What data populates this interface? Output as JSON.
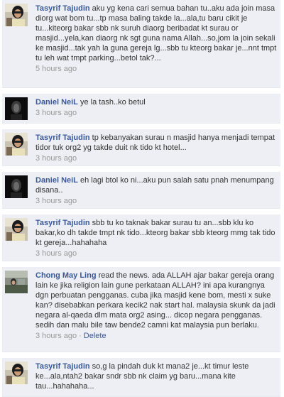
{
  "comments": [
    {
      "author": "Tasyrif Tajudin",
      "text": "aku yg kena cari semua bahan tu..aku ada join masa diorg wat bom tu...tp masa baling takde la...ala,tu baru cikit je tu...kiteorg bakar sbb nk suruh diaorg beribadat kt surau or masjid...yela,kan diaorg nk sgt guna nama Allah...so,jom la join sekali ke masjid...tak yah la guna gereja lg...sbb tu kteorg bakar je...nnt tmpt tu leh wat tmpt parking...betol tak?...",
      "time": "5 hours ago"
    },
    {
      "author": "Daniel NeiL",
      "text": "ye la tash..ko betul",
      "time": "3 hours ago"
    },
    {
      "author": "Tasyrif Tajudin",
      "text": "tp kebanyakan surau n masjid hanya menjadi tempat tidor tuk org2 yg takde duit nk tido kt hotel...",
      "time": "3 hours ago"
    },
    {
      "author": "Daniel NeiL",
      "text": "eh lagi btol ko ni...aku pun salah satu pnah menumpang disana..",
      "time": "3 hours ago"
    },
    {
      "author": "Tasyrif Tajudin",
      "text": "sbb tu ko taknak bakar surau tu an...sbb klu ko bakar,ko dh takde tmpt nk tido...kteorg bakar sbb kteorg mmg tak tido kt gereja...hahahaha",
      "time": "3 hours ago"
    },
    {
      "author": "Chong May Ling",
      "text": "read the news. ada ALLAH ajar bakar gereja orang lain ke jika religion lain gune perkataan ALLAH? ini apa kurangnya dgn perbuatan pengganas. cuba jika masjid kene bom, mesti x suke kan? disebabkan perkara kecik2 nak start hal. malaysia skunk da jadi negara al-qaeda dlm mata org2 asing... dicop negara pengganas. sedih dan malu bile taw bende2 camni kat malaysia pun berlaku.",
      "time": "3 hours ago",
      "delete": "Delete"
    },
    {
      "author": "Tasyrif Tajudin",
      "text": "so,g la pindah duk kt mana2 je...kt timur leste ke...ala,ntah2 bakar sndr sbb nk claim yg baru...mana kite tau...hahahaha...",
      "time": ""
    }
  ],
  "separator": "·"
}
